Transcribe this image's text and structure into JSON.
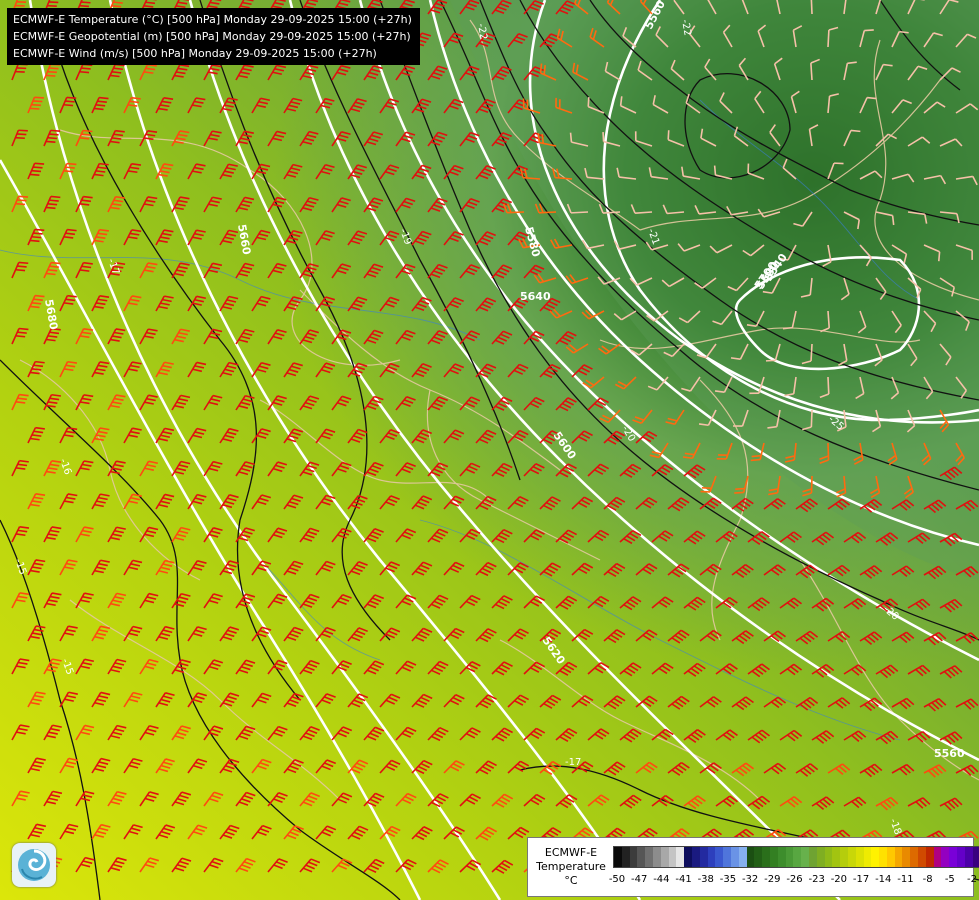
{
  "titles": [
    "ECMWF-E Temperature (°C) [500 hPa] Monday 29-09-2025 15:00 (+27h)",
    "ECMWF-E Geopotential (m) [500 hPa] Monday 29-09-2025 15:00 (+27h)",
    "ECMWF-E Wind (m/s) [500 hPa] Monday 29-09-2025 15:00 (+27h)"
  ],
  "contour_labels": {
    "geopotential": [
      "5560",
      "5580",
      "5600",
      "5620",
      "5640",
      "5660",
      "5680",
      "5700",
      "5580",
      "5540",
      "5560"
    ],
    "temperature": [
      "-22",
      "-22",
      "-21",
      "-17",
      "-16",
      "-15",
      "-15",
      "-17",
      "-19",
      "-20",
      "-25",
      "-20",
      "-18",
      "-2"
    ]
  },
  "legend": {
    "title_line1": "ECMWF-E",
    "title_line2": "Temperature",
    "unit": "°C",
    "ticks": [
      "-50",
      "-47",
      "-44",
      "-41",
      "-38",
      "-35",
      "-32",
      "-29",
      "-26",
      "-23",
      "-20",
      "-17",
      "-14",
      "-11",
      "-8",
      "-5",
      "-2"
    ],
    "colors": [
      "#0a0a0a",
      "#222222",
      "#3c3c3c",
      "#565656",
      "#707070",
      "#8c8c8c",
      "#a8a8a8",
      "#c4c4c4",
      "#e6e6e6",
      "#0d0d5c",
      "#1a1a80",
      "#232aa0",
      "#2d3fbd",
      "#3a58cf",
      "#4f75db",
      "#6a93e6",
      "#86b0ef",
      "#1b4f12",
      "#225f16",
      "#2a6f1b",
      "#337f22",
      "#3d8d2c",
      "#4a9a36",
      "#58a741",
      "#67b14c",
      "#6fa332",
      "#7fae22",
      "#8fba18",
      "#a2c411",
      "#b5cd0c",
      "#c8d708",
      "#dbe104",
      "#eeeb02",
      "#fff200",
      "#ffe100",
      "#ffc800",
      "#f5a700",
      "#e98a00",
      "#dd6a00",
      "#d04a00",
      "#c02800",
      "#b00080",
      "#9400c0",
      "#7a00d8",
      "#6400c8",
      "#4c00a8",
      "#3a007f"
    ]
  },
  "logo_name": "ecmwf-logo"
}
